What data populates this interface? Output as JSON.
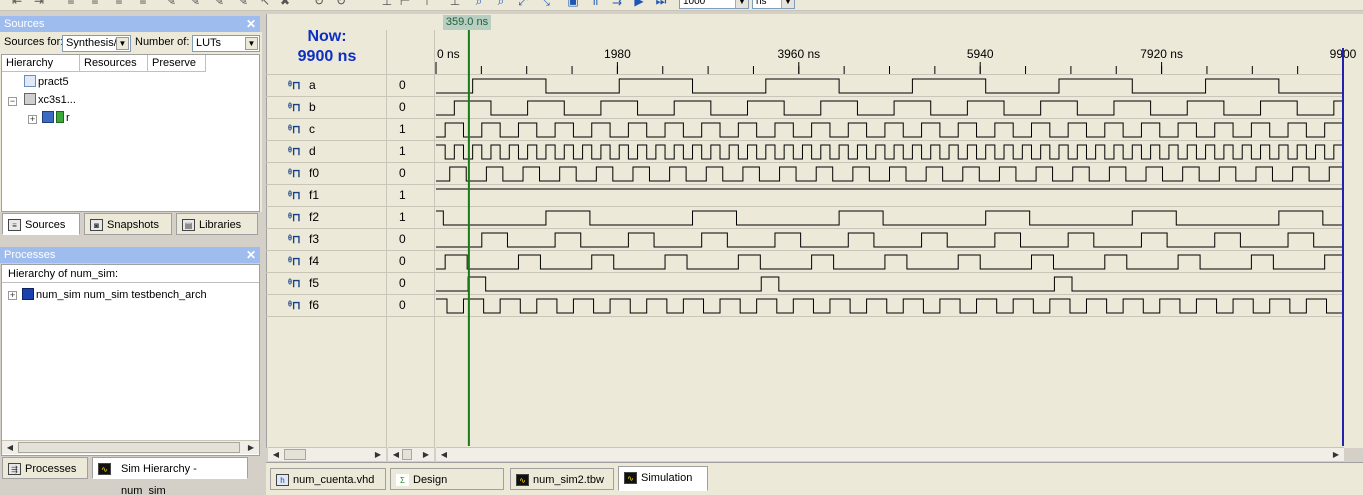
{
  "toolbar": {
    "run_value": "1000",
    "run_unit": "ns"
  },
  "sources_panel": {
    "title": "Sources",
    "close": "✕",
    "sources_for_label": "Sources for:",
    "sources_for_value": "Synthesis/",
    "number_of_label": "Number of:",
    "number_of_value": "LUTs",
    "columns": [
      "Hierarchy",
      "Resources",
      "Preserve"
    ],
    "tree": {
      "project": "pract5",
      "device": "xc3s1...",
      "module": "r"
    },
    "tabs": [
      "Sources",
      "Snapshots",
      "Libraries"
    ]
  },
  "processes_panel": {
    "title": "Processes",
    "close": "✕",
    "header": "Hierarchy of num_sim:",
    "item": "num_sim num_sim testbench_arch",
    "tabs": [
      "Processes",
      "Sim Hierarchy - num_sim"
    ]
  },
  "simulation": {
    "now_label": "Now:",
    "now_value": "9900 ns",
    "cursor_label": "359.0 ns",
    "cursor_time_ns": 359,
    "time_start_ns": 0,
    "time_end_ns": 9900,
    "time_labels": [
      "0 ns",
      "1980",
      "3960 ns",
      "5940",
      "7920 ns",
      "9900"
    ],
    "signals": [
      {
        "name": "a",
        "value": "0",
        "period_ns": 1600,
        "duty": 0.5,
        "phase_ns": 400
      },
      {
        "name": "b",
        "value": "0",
        "period_ns": 800,
        "duty": 0.5,
        "phase_ns": 200
      },
      {
        "name": "c",
        "value": "1",
        "period_ns": 400,
        "duty": 0.5,
        "phase_ns": 100
      },
      {
        "name": "d",
        "value": "1",
        "period_ns": 200,
        "duty": 0.5,
        "phase_ns": 0
      },
      {
        "name": "f0",
        "value": "0",
        "period_ns": 400,
        "duty": 0.45,
        "phase_ns": 150
      },
      {
        "name": "f1",
        "value": "1",
        "period_ns": 0,
        "duty": 1,
        "phase_ns": 0
      },
      {
        "name": "f2",
        "value": "1",
        "period_ns": 1600,
        "duty": 0.3,
        "phase_ns": 1200
      },
      {
        "name": "f3",
        "value": "0",
        "period_ns": 800,
        "duty": 0.35,
        "phase_ns": 500
      },
      {
        "name": "f4",
        "value": "0",
        "period_ns": 800,
        "duty": 0.3,
        "phase_ns": 100
      },
      {
        "name": "f5",
        "value": "0",
        "period_ns": 3200,
        "duty": 0.06,
        "phase_ns": 350
      },
      {
        "name": "f6",
        "value": "0",
        "period_ns": 400,
        "duty": 0.55,
        "phase_ns": 300
      }
    ]
  },
  "editor_tabs": [
    "num_cuenta.vhd",
    "Design Summary",
    "num_sim2.tbw",
    "Simulation"
  ],
  "colors": {
    "wave": "#000000",
    "cursor": "#1a7a1a",
    "end_marker": "#2222aa",
    "panel_title": "#9ebdee",
    "now_text": "#0d2fc2"
  }
}
